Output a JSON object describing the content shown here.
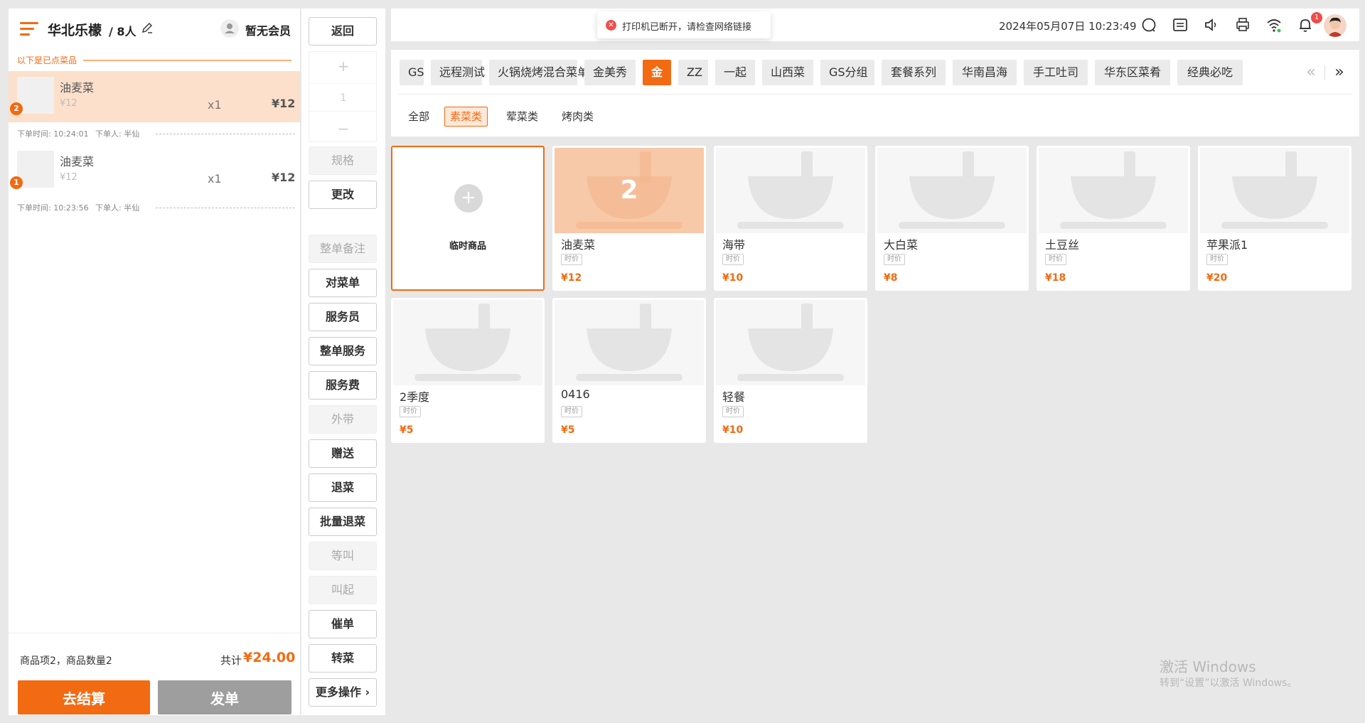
{
  "order": {
    "table_name": "华北乐檬",
    "people": "/ 8人",
    "member_label": "暂无会员",
    "ordered_label": "以下是已点菜品",
    "items": [
      {
        "badge": "2",
        "name": "油麦菜",
        "unit_price": "¥12",
        "qty": "x1",
        "total": "¥12",
        "order_time": "下单时间: 10:24:01",
        "orderer": "下单人: 半仙"
      },
      {
        "badge": "1",
        "name": "油麦菜",
        "unit_price": "¥12",
        "qty": "x1",
        "total": "¥12",
        "order_time": "下单时间: 10:23:56",
        "orderer": "下单人: 半仙"
      }
    ],
    "summary": "商品项2，商品数量2",
    "total_label": "共计",
    "total_value": "¥24.00",
    "checkout_label": "去结算",
    "send_label": "发单"
  },
  "actions": {
    "back": "返回",
    "stepper_plus": "+",
    "stepper_value": "1",
    "stepper_minus": "−",
    "spec": "规格",
    "modify": "更改",
    "order_note": "整单备注",
    "check_order": "对菜单",
    "waiter": "服务员",
    "order_service": "整单服务",
    "service_fee": "服务费",
    "takeaway": "外带",
    "gift": "赠送",
    "return_dish": "退菜",
    "batch_return": "批量退菜",
    "wait_call": "等叫",
    "call": "叫起",
    "rush": "催单",
    "transfer": "转菜",
    "more": "更多操作 ›"
  },
  "topbar": {
    "toast_icon": "✕",
    "toast": "打印机已断开，请检查网络链接",
    "datetime": "2024年05月07日 10:23:49",
    "bell_badge": "1"
  },
  "categories": [
    "GS",
    "远程测试",
    "火锅烧烤混合菜单",
    "金美秀",
    "金",
    "ZZ",
    "一起",
    "山西菜",
    "GS分组",
    "套餐系列",
    "华南昌海",
    "手工吐司",
    "华东区菜肴",
    "经典必吃"
  ],
  "category_nav": {
    "prev": "«",
    "next": "»"
  },
  "subcategories": [
    "全部",
    "素菜类",
    "荤菜类",
    "烤肉类"
  ],
  "temp_product": {
    "plus": "+",
    "label": "临时商品"
  },
  "products": [
    {
      "name": "油麦菜",
      "tag": "时价",
      "price": "¥12",
      "qty": "2"
    },
    {
      "name": "海带",
      "tag": "时价",
      "price": "¥10"
    },
    {
      "name": "大白菜",
      "tag": "时价",
      "price": "¥8"
    },
    {
      "name": "土豆丝",
      "tag": "时价",
      "price": "¥18"
    },
    {
      "name": "苹果派1",
      "tag": "时价",
      "price": "¥20"
    },
    {
      "name": "2季度",
      "tag": "时价",
      "price": "¥5"
    },
    {
      "name": "0416",
      "tag": "时价",
      "price": "¥5"
    },
    {
      "name": "轻餐",
      "tag": "时价",
      "price": "¥10"
    }
  ],
  "watermark": {
    "line1": "激活 Windows",
    "line2": "转到“设置”以激活 Windows。"
  },
  "colors": {
    "accent": "#f26a12",
    "accent_light": "#fde0cb",
    "disabled_btn": "#9e9e9e"
  }
}
